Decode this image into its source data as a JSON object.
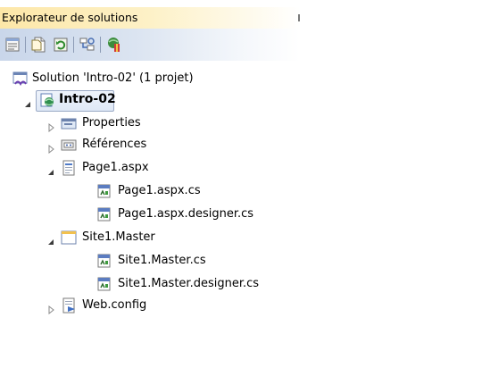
{
  "window": {
    "title": "Explorateur de solutions"
  },
  "toolbar": {
    "buttons": [
      {
        "name": "properties-button",
        "icon": "properties-icon"
      },
      {
        "name": "show-all-files-button",
        "icon": "show-all-files-icon"
      },
      {
        "name": "refresh-button",
        "icon": "refresh-icon"
      },
      {
        "name": "view-class-diagram-button",
        "icon": "class-diagram-icon"
      },
      {
        "name": "copy-website-button",
        "icon": "copy-website-icon"
      }
    ]
  },
  "tree": {
    "solution": {
      "label": "Solution 'Intro-02' (1 projet)",
      "icon": "solution-icon"
    },
    "project": {
      "label": "Intro-02",
      "icon": "web-project-icon",
      "expanded": true,
      "selected": true
    },
    "items": [
      {
        "label": "Properties",
        "icon": "properties-folder-icon",
        "expandable": true,
        "expanded": false,
        "level": 2
      },
      {
        "label": "Références",
        "icon": "references-icon",
        "expandable": true,
        "expanded": false,
        "level": 2
      },
      {
        "label": "Page1.aspx",
        "icon": "aspx-page-icon",
        "expandable": true,
        "expanded": true,
        "level": 2
      },
      {
        "label": "Page1.aspx.cs",
        "icon": "cs-file-icon",
        "expandable": false,
        "level": 3
      },
      {
        "label": "Page1.aspx.designer.cs",
        "icon": "cs-file-icon",
        "expandable": false,
        "level": 3
      },
      {
        "label": "Site1.Master",
        "icon": "master-page-icon",
        "expandable": true,
        "expanded": true,
        "level": 2
      },
      {
        "label": "Site1.Master.cs",
        "icon": "cs-file-icon",
        "expandable": false,
        "level": 3
      },
      {
        "label": "Site1.Master.designer.cs",
        "icon": "cs-file-icon",
        "expandable": false,
        "level": 3
      },
      {
        "label": "Web.config",
        "icon": "config-file-icon",
        "expandable": true,
        "expanded": false,
        "level": 2
      }
    ]
  },
  "colors": {
    "title_gradient_start": "#fde7a8",
    "toolbar_gradient_start": "#c9d6ea",
    "selection_border": "#9aa9c5"
  }
}
